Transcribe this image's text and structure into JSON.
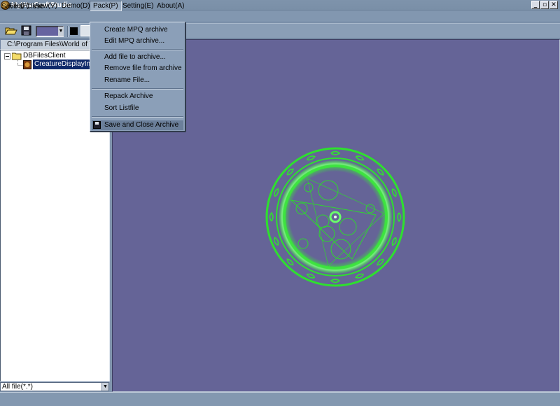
{
  "window": {
    "title": "MyWarCraftStudio"
  },
  "menubar": [
    {
      "label": "File(F)"
    },
    {
      "label": "View(V)"
    },
    {
      "label": "Demo(D)"
    },
    {
      "label": "Pack(P)"
    },
    {
      "label": "Setting(E)"
    },
    {
      "label": "About(A)"
    }
  ],
  "pack_menu": {
    "items": [
      "Create MPQ archive",
      "Edit MPQ archive...",
      "Add file to archive...",
      "Remove file from archive",
      "Rename File...",
      "Repack Archive",
      "Sort Listfile",
      "Save and Close Archive"
    ]
  },
  "left_panel": {
    "path": "C:\\Program Files\\World of Warcraft",
    "tree": {
      "folder": "DBFilesClient",
      "file": "CreatureDisplayInfo.dbc"
    },
    "filter": "All file(*.*)"
  },
  "status": {
    "text": "Save & Close"
  },
  "colors": {
    "canvas_bg": "#656497",
    "glow": "#3ae83a",
    "highlight": "#6b7f9a"
  },
  "icons": [
    "app-icon",
    "minimize-icon",
    "restore-icon",
    "close-icon",
    "open-folder-icon",
    "save-disk-icon",
    "folder-icon",
    "file-icon"
  ]
}
